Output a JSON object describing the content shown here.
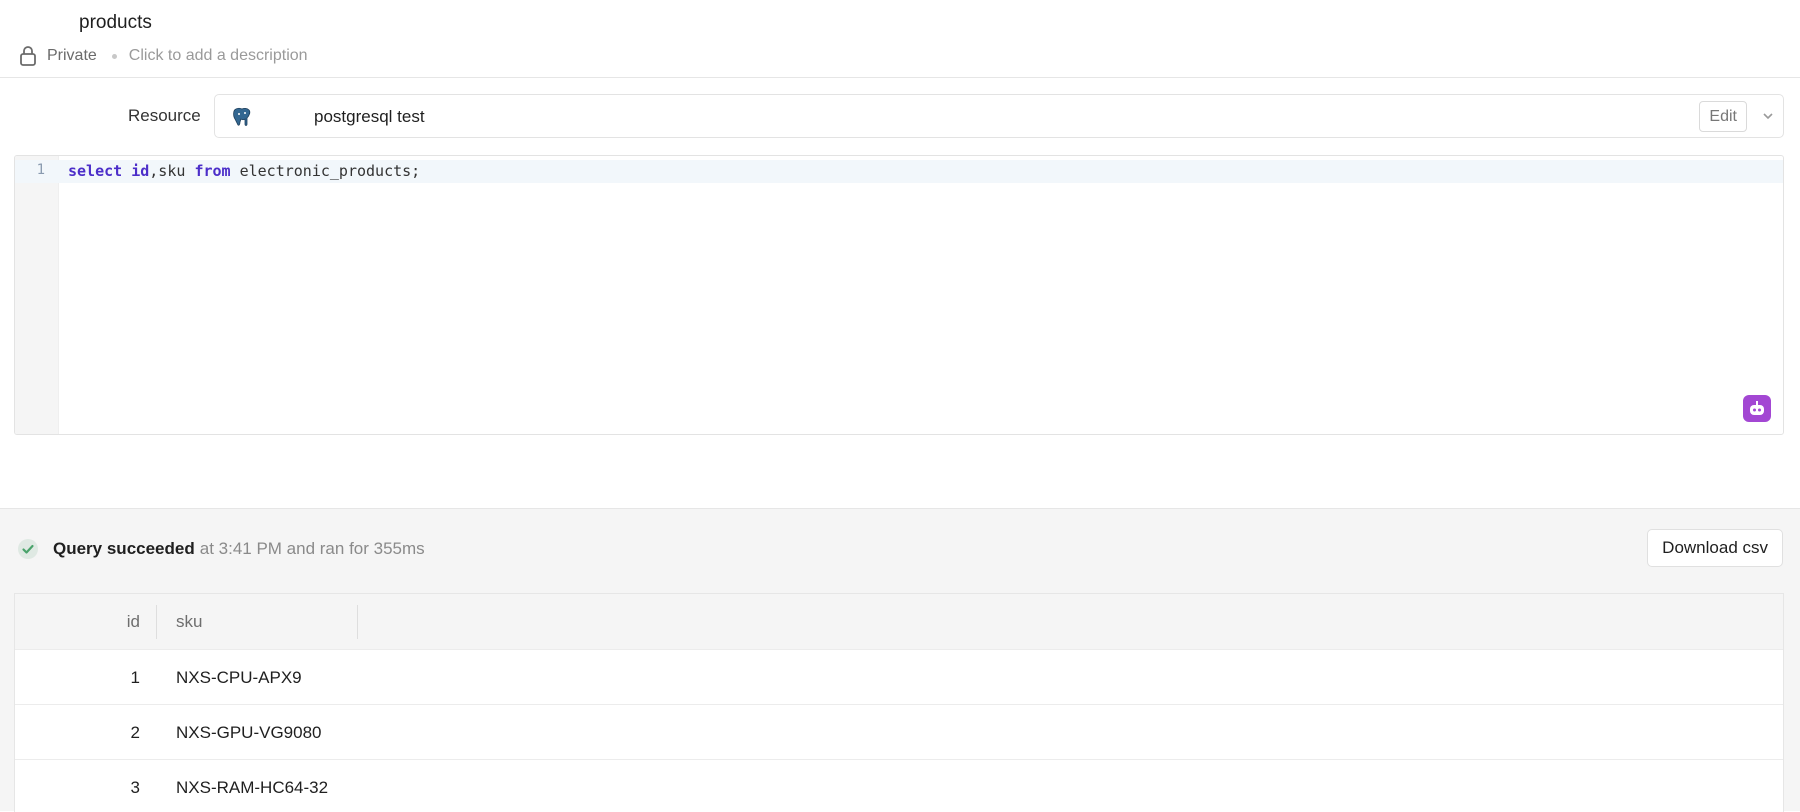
{
  "header": {
    "title": "products",
    "visibility": "Private",
    "description_placeholder": "Click to add a description"
  },
  "resource": {
    "label": "Resource",
    "name": "postgresql test",
    "icon": "postgresql-elephant-icon",
    "edit_label": "Edit"
  },
  "editor": {
    "line_number": "1",
    "code_tokens": [
      {
        "text": "select",
        "kw": true
      },
      {
        "text": " ",
        "kw": false
      },
      {
        "text": "id",
        "kw": true
      },
      {
        "text": ",sku ",
        "kw": false
      },
      {
        "text": "from",
        "kw": true
      },
      {
        "text": " electronic_products;",
        "kw": false
      }
    ],
    "ai_icon": "robot-assistant-icon"
  },
  "results": {
    "status_strong": "Query succeeded",
    "status_rest": "at 3:41 PM and ran for 355ms",
    "download_label": "Download csv",
    "columns": [
      "id",
      "sku"
    ],
    "rows": [
      {
        "id": "1",
        "sku": "NXS-CPU-APX9"
      },
      {
        "id": "2",
        "sku": "NXS-GPU-VG9080"
      },
      {
        "id": "3",
        "sku": "NXS-RAM-HC64-32"
      }
    ]
  },
  "colors": {
    "keyword": "#4c2ec9",
    "ai_button": "#a347d3",
    "success": "#4aa36b"
  }
}
